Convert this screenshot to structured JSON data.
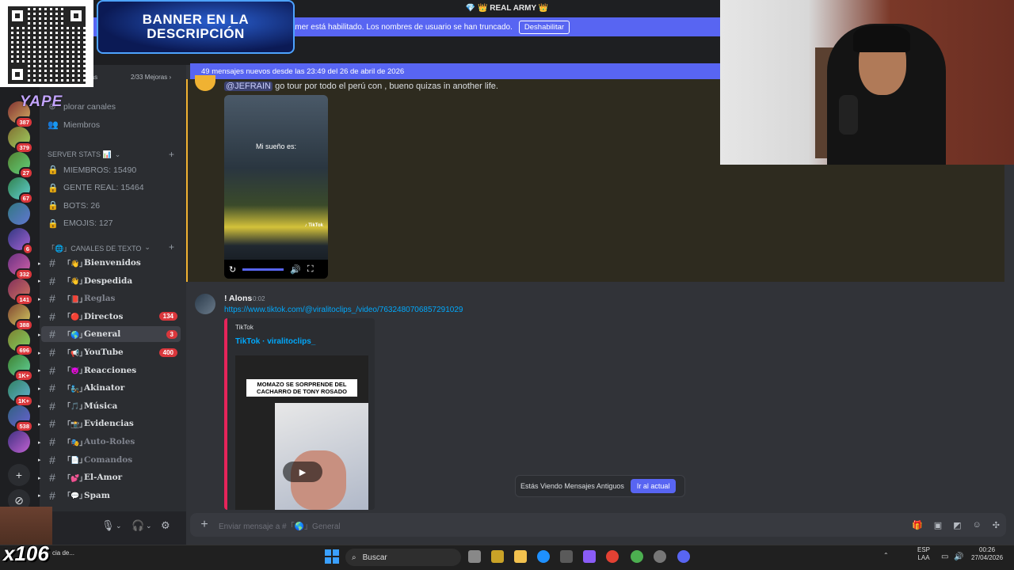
{
  "window": {
    "title": "💎 👑 REAL ARMY 👑"
  },
  "streamer_banner": {
    "text": "El modo Streamer está habilitado. Los nombres de usuario se han truncado.",
    "button": "Deshabilitar"
  },
  "overlay": {
    "banner_text": "BANNER EN LA DESCRIPCIÓN",
    "yape": "YAPE",
    "multiplier": "x106"
  },
  "servers": [
    {
      "badge": "387"
    },
    {
      "badge": "379"
    },
    {
      "badge": "27"
    },
    {
      "badge": "67"
    },
    {
      "badge": ""
    },
    {
      "badge": "6"
    },
    {
      "badge": "332"
    },
    {
      "badge": "141"
    },
    {
      "badge": "388"
    },
    {
      "badge": "696"
    },
    {
      "badge": "1K+"
    },
    {
      "badge": "1K+"
    },
    {
      "badge": "538"
    },
    {
      "badge": ""
    }
  ],
  "sidebar": {
    "boosts": "2/33 Mejoras ›",
    "boosts_partial": "ras",
    "explore": "plorar canales",
    "members": "Miembros",
    "stats_category": "SERVER STATS 📊",
    "stats": [
      "MIEMBROS: 15490",
      "GENTE REAL: 15464",
      "BOTS: 26",
      "EMOJIS: 127"
    ],
    "text_category": "「🌐」CANALES DE TEXTO",
    "channels": [
      {
        "emoji": "「👋」",
        "name": "Bienvenidos",
        "count": ""
      },
      {
        "emoji": "「👋」",
        "name": "Despedida",
        "count": ""
      },
      {
        "emoji": "「📕」",
        "name": "Reglas",
        "count": ""
      },
      {
        "emoji": "「🔴」",
        "name": "Directos",
        "count": "134"
      },
      {
        "emoji": "「🌎」",
        "name": "General",
        "count": "3"
      },
      {
        "emoji": "「📢」",
        "name": "YouTube",
        "count": "400"
      },
      {
        "emoji": "「😈」",
        "name": "Reacciones",
        "count": ""
      },
      {
        "emoji": "「🧞」",
        "name": "Akinator",
        "count": ""
      },
      {
        "emoji": "「🎵」",
        "name": "Música",
        "count": ""
      },
      {
        "emoji": "「📸」",
        "name": "Evidencias",
        "count": ""
      },
      {
        "emoji": "「🎭」",
        "name": "Auto-Roles",
        "count": ""
      },
      {
        "emoji": "「📄」",
        "name": "Comandos",
        "count": ""
      },
      {
        "emoji": "「💕」",
        "name": "El-Amor",
        "count": ""
      },
      {
        "emoji": "「💬」",
        "name": "Spam",
        "count": ""
      }
    ]
  },
  "new_messages_bar": "49 mensajes nuevos desde las 23:49 del 26 de abril de 2026",
  "messages": {
    "m1": {
      "mention": "@JEFRAIN",
      "text": " go tour por todo el perú con , bueno quizas in another life.",
      "video_caption": "Mi sueño es:",
      "video_brand": "♪ TikTok"
    },
    "m2": {
      "author": "! Alons",
      "time": "0:02",
      "link": "https://www.tiktok.com/@viralitoclips_/video/7632480706857291029",
      "embed_provider": "TikTok",
      "embed_title": "TikTok · viralitoclips_",
      "thumb_text": "MOMAZO SE SORPRENDE DEL CACHARRO DE TONY ROSADO"
    }
  },
  "jump_bar": {
    "text": "Estás Viendo Mensajes Antiguos",
    "button": "Ir al actual"
  },
  "composer": {
    "placeholder": "Enviar mensaje a #「🌎」General"
  },
  "taskbar": {
    "note": "cia de...",
    "search": "Buscar",
    "lang1": "ESP",
    "lang2": "LAA",
    "clock_time": "00:26",
    "clock_date": "27/04/2026"
  }
}
